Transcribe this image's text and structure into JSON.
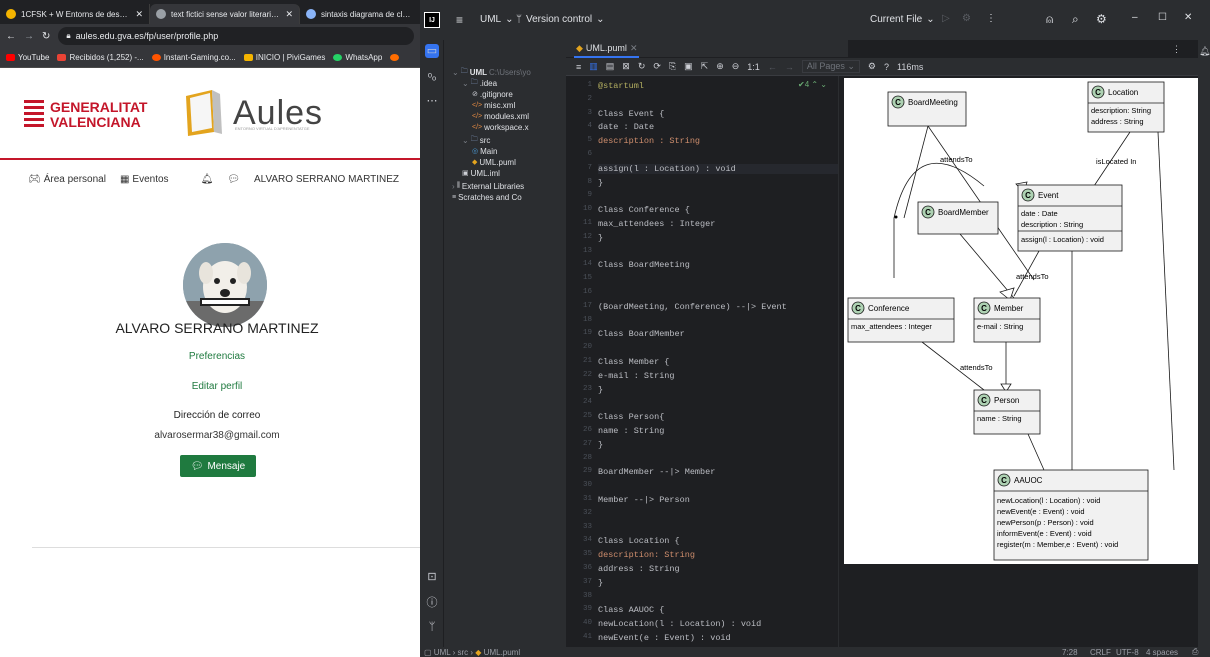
{
  "browser": {
    "tabs": [
      {
        "title": "1CFSK + W Entorns de desenrot",
        "color": "#f4b400",
        "active": false
      },
      {
        "title": "text fictici sense valor literari, po",
        "color": "#9aa0a6",
        "active": true
      },
      {
        "title": "sintaxis diagrama de clase",
        "color": "#8ab4f8",
        "active": false
      }
    ],
    "url": "aules.edu.gva.es/fp/user/profile.php",
    "bookmarks": [
      {
        "label": "YouTube",
        "color": "#ff0000"
      },
      {
        "label": "Recibidos (1,252) -...",
        "color": "#ea4335"
      },
      {
        "label": "Instant-Gaming.co...",
        "color": "#ff5400"
      },
      {
        "label": "INICIO | PiviGames",
        "color": "#f4b400"
      },
      {
        "label": "WhatsApp",
        "color": "#25d366"
      }
    ]
  },
  "aules": {
    "gv_line1": "GENERALITAT",
    "gv_line2": "VALENCIANA",
    "logo_text": "Aules",
    "logo_sub": "ENTORNO VIRTUAL D'APRENENTATGE",
    "nav": {
      "area": "Área personal",
      "events": "Eventos",
      "user": "ALVARO SERRANO MARTINEZ"
    },
    "profile_name": "ALVARO SERRANO MARTINEZ",
    "preferences": "Preferencias",
    "edit_profile": "Editar perfil",
    "email_label": "Dirección de correo",
    "email_value": "alvarosermar38@gmail.com",
    "message_button": "Mensaje"
  },
  "ide": {
    "project_name": "UML",
    "vcs": "Version control",
    "run_config": "Current File",
    "tree": [
      {
        "label": "UML",
        "suffix": "C:\\Users\\yo",
        "depth": 0,
        "icon": "folder-icon"
      },
      {
        "label": ".idea",
        "depth": 1,
        "icon": "folder-icon"
      },
      {
        "label": ".gitignore",
        "depth": 2,
        "icon": "file-icon"
      },
      {
        "label": "misc.xml",
        "depth": 2,
        "icon": "xml-icon"
      },
      {
        "label": "modules.xml",
        "depth": 2,
        "icon": "xml-icon"
      },
      {
        "label": "workspace.x",
        "depth": 2,
        "icon": "xml-icon"
      },
      {
        "label": "src",
        "depth": 1,
        "icon": "folder-icon"
      },
      {
        "label": "Main",
        "depth": 2,
        "icon": "class-icon"
      },
      {
        "label": "UML.puml",
        "depth": 2,
        "icon": "puml-icon"
      },
      {
        "label": "UML.iml",
        "depth": 1,
        "icon": "module-icon"
      },
      {
        "label": "External Libraries",
        "depth": 0,
        "icon": "library-icon"
      },
      {
        "label": "Scratches and Co",
        "depth": 0,
        "icon": "scratch-icon"
      }
    ],
    "editor_tab": "UML.puml",
    "warnings": "4",
    "zoom_label": "1:1",
    "all_pages": "All Pages",
    "help": "?",
    "render_time": "116ms",
    "code_lines": [
      "@startuml",
      "",
      "Class Event {",
      "date : Date",
      "description : String",
      "",
      "assign(l : Location) : void",
      "}",
      "",
      "Class Conference {",
      "max_attendees : Integer",
      "}",
      "",
      "Class BoardMeeting",
      "",
      "",
      "(BoardMeeting, Conference) --|> Event",
      "",
      "Class BoardMember",
      "",
      "Class Member {",
      "e-mail : String",
      "}",
      "",
      "Class Person{",
      "name : String",
      "}",
      "",
      "BoardMember --|> Member",
      "",
      "Member --|> Person",
      "",
      "",
      "Class Location {",
      "description: String",
      "address : String",
      "}",
      "",
      "Class AAUOC {",
      "newLocation(l : Location) : void",
      "newEvent(e : Event) : void"
    ],
    "status": {
      "breadcrumb": [
        "UML",
        "src",
        "UML.puml"
      ],
      "position": "7:28",
      "line_sep": "CRLF",
      "encoding": "UTF-8",
      "indent": "4 spaces"
    }
  },
  "diagram": {
    "classes": [
      {
        "name": "BoardMeeting",
        "attrs": [],
        "methods": []
      },
      {
        "name": "Location",
        "attrs": [
          "description: String",
          "address : String"
        ],
        "methods": []
      },
      {
        "name": "Event",
        "attrs": [
          "date : Date",
          "description : String"
        ],
        "methods": [
          "assign(l : Location) : void"
        ]
      },
      {
        "name": "BoardMember",
        "attrs": [],
        "methods": []
      },
      {
        "name": "Conference",
        "attrs": [
          "max_attendees : Integer"
        ],
        "methods": []
      },
      {
        "name": "Member",
        "attrs": [
          "e-mail : String"
        ],
        "methods": []
      },
      {
        "name": "Person",
        "attrs": [
          "name : String"
        ],
        "methods": []
      },
      {
        "name": "AAUOC",
        "attrs": [],
        "methods": [
          "newLocation(l : Location) : void",
          "newEvent(e : Event) : void",
          "newPerson(p : Person) : void",
          "informEvent(e : Event) : void",
          "register(m : Member,e : Event) : void"
        ]
      }
    ],
    "labels": {
      "attendsTo1": "attendsTo",
      "isLocatedIn": "isLocated In",
      "attendsTo2": "attendsTo",
      "attendsTo3": "attendsTo"
    }
  }
}
